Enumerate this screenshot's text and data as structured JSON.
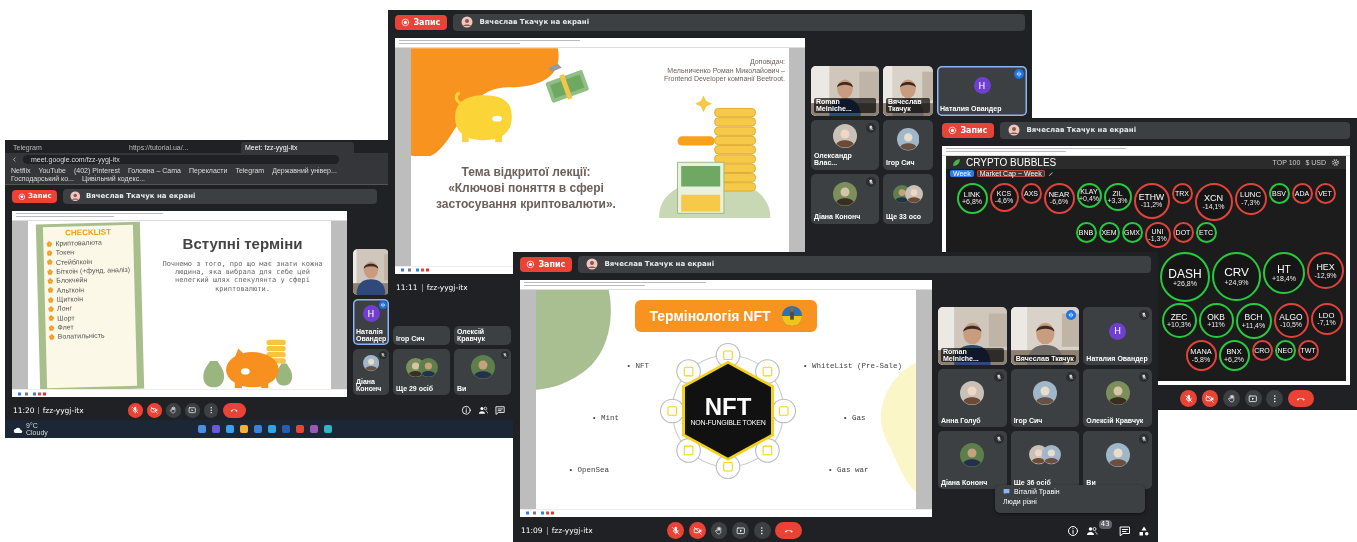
{
  "windows": [
    {
      "browser": {
        "tabs": [
          {
            "label": "Telegram",
            "selected": false
          },
          {
            "label": "https://tutorial.ua/...",
            "selected": false
          },
          {
            "label": "Meet: fzz-yygj-itx",
            "selected": true
          }
        ],
        "url": "meet.google.com/fzz-yygj-itx",
        "bookmarks": [
          "Netflix",
          "YouTube",
          "(402) Pinterest",
          "Головна – Cama",
          "Перекласти",
          "Telegram",
          "Державний універ...",
          "Господарський ко...",
          "Цивільний кодекс..."
        ]
      },
      "recording": "Запис",
      "presenter": "Вячеслав Ткачук на екрані",
      "slide": {
        "kind": "checklist",
        "checklist_title": "CHECKLIST",
        "items": [
          "Криптовалюта",
          "Токен",
          "Стейблкоін",
          "Біткоін (+фунд. аналіз)",
          "Блокчейн",
          "Альткоін",
          "Щиткоін",
          "Лонг",
          "Шорт",
          "Флет",
          "Волатильність"
        ],
        "title": "Вступні терміни",
        "text": "Почнемо з того, про що має знати кожна людина, яка вибрала для себе цей нелегкий шлях спекулянта у сфері криптовалюти."
      },
      "tiles": [
        {
          "kind": "video",
          "muted": false,
          "speaking": false
        },
        {
          "name": "Наталія Овандер",
          "kind": "initial",
          "initial": "H",
          "muted": false,
          "speaking": true
        },
        {
          "name": "Ігор Сич",
          "kind": "name-only",
          "muted": false,
          "speaking": false
        },
        {
          "name": "Олексій Кравчук",
          "kind": "name-only",
          "muted": false,
          "speaking": false
        },
        {
          "name": "Діана Кононч",
          "muted": true,
          "speaking": false
        },
        {
          "name": "Ще 29 осіб",
          "kind": "group",
          "muted": false,
          "speaking": false
        },
        {
          "name": "Ви",
          "muted": true,
          "speaking": false
        }
      ],
      "footer": {
        "time": "11:20",
        "meeting_code": "fzz-yygj-itx",
        "controls": [
          {
            "kind": "mic",
            "on": false
          },
          {
            "kind": "camera",
            "on": false
          },
          {
            "kind": "hand"
          },
          {
            "kind": "present"
          },
          {
            "kind": "more"
          },
          {
            "kind": "hangup"
          }
        ],
        "tools": [
          {
            "kind": "info"
          },
          {
            "kind": "people"
          },
          {
            "kind": "chat"
          }
        ]
      },
      "taskbar": {
        "temperature": "9°C",
        "weather": "Cloudy"
      }
    },
    {
      "recording": "Запис",
      "presenter": "Вячеслав Ткачук на екрані",
      "slide": {
        "kind": "lecture",
        "speaker_lines": [
          "Доповідач:",
          "Мельниченко Роман Миколайович –",
          "Frontend Developer компанії Beetroot."
        ],
        "title_lines": [
          "Тема відкритої лекції:",
          "«Ключові поняття в сфері",
          "застосування криптовалюти»."
        ]
      },
      "tiles": [
        {
          "name": "Roman Melniche...",
          "kind": "video",
          "muted": false,
          "speaking": false
        },
        {
          "name": "Вячеслав Ткачук",
          "kind": "video",
          "muted": false,
          "speaking": false
        },
        {
          "name": "Наталия Овандер",
          "kind": "initial",
          "initial": "H",
          "muted": false,
          "speaking": true
        },
        {
          "name": "Олександр Влас...",
          "muted": true,
          "speaking": false
        },
        {
          "name": "Ігор Сич",
          "muted": false,
          "speaking": false
        },
        {
          "name": "Діана Кононч",
          "muted": true,
          "speaking": false
        },
        {
          "name": "Ще 33 осо",
          "kind": "group",
          "muted": false,
          "speaking": false
        }
      ],
      "footer": {
        "time": "11:11",
        "meeting_code": "fzz-yygj-itx"
      }
    },
    {
      "recording": "Запис",
      "presenter": "Вячеслав Ткачук на екрані",
      "slide": {
        "kind": "bubbles",
        "app_title": "CRYPTO BUBBLES",
        "range": "TOP 100",
        "currency": "$ USD",
        "period": "Week",
        "metric": "Market Cap ~ Week",
        "bubbles_top": [
          {
            "label": "LINK",
            "change": "+6,8%",
            "color": "#27c93f"
          },
          {
            "label": "KCS",
            "change": "-4,6%",
            "color": "#e0433b"
          },
          {
            "label": "AXS",
            "color": "#e0433b"
          },
          {
            "label": "NEAR",
            "change": "-6,6%",
            "color": "#e0433b"
          },
          {
            "label": "KLAY",
            "change": "+0,4%",
            "color": "#27c93f"
          },
          {
            "label": "ZIL",
            "change": "+3,3%",
            "color": "#27c93f"
          },
          {
            "label": "ETHW",
            "change": "-11,2%",
            "color": "#e0433b"
          },
          {
            "label": "TRX",
            "color": "#e0433b"
          },
          {
            "label": "XCN",
            "change": "-14,1%",
            "color": "#e0433b"
          },
          {
            "label": "LUNC",
            "change": "-7,3%",
            "color": "#e0433b"
          },
          {
            "label": "BSV",
            "color": "#27c93f"
          },
          {
            "label": "ADA",
            "color": "#e0433b"
          },
          {
            "label": "VET",
            "color": "#e0433b"
          },
          {
            "label": "BNB",
            "color": "#27c93f"
          },
          {
            "label": "XEM",
            "color": "#27c93f"
          },
          {
            "label": "GMX",
            "color": "#27c93f"
          },
          {
            "label": "UNI",
            "change": "-1,3%",
            "color": "#e0433b"
          },
          {
            "label": "DOT",
            "color": "#e0433b"
          },
          {
            "label": "ETC",
            "color": "#27c93f"
          }
        ],
        "bubbles_side": [
          {
            "label": "DASH",
            "change": "+26,8%",
            "color": "#27c93f"
          },
          {
            "label": "CRV",
            "change": "+24,9%",
            "color": "#27c93f"
          },
          {
            "label": "HT",
            "change": "+18,4%",
            "color": "#27c93f"
          },
          {
            "label": "HEX",
            "change": "-12,9%",
            "color": "#e0433b"
          },
          {
            "label": "ZEC",
            "change": "+10,3%",
            "color": "#27c93f"
          },
          {
            "label": "OKB",
            "change": "+11%",
            "color": "#27c93f"
          },
          {
            "label": "BCH",
            "change": "+11,4%",
            "color": "#27c93f"
          },
          {
            "label": "ALGO",
            "change": "-10,5%",
            "color": "#e0433b"
          },
          {
            "label": "LDO",
            "change": "-7,1%",
            "color": "#e0433b"
          },
          {
            "label": "MANA",
            "change": "-5,8%",
            "color": "#e0433b"
          },
          {
            "label": "BNX",
            "change": "+6,2%",
            "color": "#27c93f"
          },
          {
            "label": "CRO",
            "color": "#e0433b"
          },
          {
            "label": "NEO",
            "color": "#27c93f"
          },
          {
            "label": "TWT",
            "color": "#e0433b"
          }
        ]
      },
      "footer": {
        "controls": [
          {
            "kind": "mic",
            "on": false
          },
          {
            "kind": "camera",
            "on": false
          },
          {
            "kind": "hand"
          },
          {
            "kind": "present"
          },
          {
            "kind": "more"
          },
          {
            "kind": "hangup"
          }
        ]
      }
    },
    {
      "recording": "Запис",
      "presenter": "Вячеслав Ткачук на екрані",
      "slide": {
        "kind": "nft",
        "title": "Термінологія NFT",
        "logo_text": "NFT",
        "logo_subtext": "NON-FUNGIBLE TOKEN",
        "terms_left": [
          "• NFT",
          "• Mint",
          "• OpenSea"
        ],
        "terms_right": [
          "• WhiteList (Pre-Sale)",
          "• Gas",
          "• Gas war"
        ]
      },
      "tiles": [
        {
          "name": "Roman Melniche...",
          "kind": "video",
          "muted": false,
          "speaking": false
        },
        {
          "name": "Вячеслав Ткачук",
          "kind": "video",
          "muted": false,
          "speaking": true
        },
        {
          "name": "Наталия Овандер",
          "kind": "initial",
          "initial": "H",
          "muted": true,
          "speaking": false
        },
        {
          "name": "Анна Голуб",
          "muted": true,
          "speaking": false
        },
        {
          "name": "Ігор Сич",
          "muted": true,
          "speaking": false
        },
        {
          "name": "Олексій Кравчук",
          "muted": true,
          "speaking": false
        },
        {
          "name": "Діана Кононч",
          "muted": true,
          "speaking": false
        },
        {
          "name": "Ще 36 осіб",
          "kind": "group",
          "muted": false,
          "speaking": false
        },
        {
          "name": "Ви",
          "muted": true,
          "speaking": false
        }
      ],
      "toast": {
        "sender": "Віталій Травін",
        "message": "Люди різні"
      },
      "footer": {
        "time": "11:09",
        "meeting_code": "fzz-yygj-itx",
        "controls": [
          {
            "kind": "mic",
            "on": false
          },
          {
            "kind": "camera",
            "on": false
          },
          {
            "kind": "hand"
          },
          {
            "kind": "present"
          },
          {
            "kind": "more"
          },
          {
            "kind": "hangup"
          }
        ],
        "tools": [
          {
            "kind": "info"
          },
          {
            "kind": "people",
            "badge": "43"
          },
          {
            "kind": "chat"
          },
          {
            "kind": "activities"
          }
        ]
      }
    }
  ]
}
